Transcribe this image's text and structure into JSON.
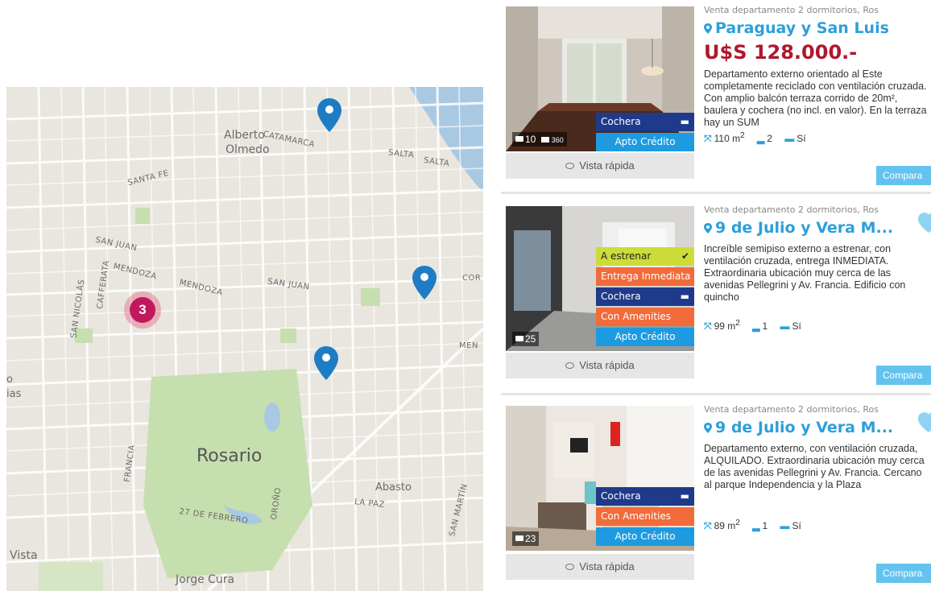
{
  "map": {
    "labels": {
      "alberto": "Alberto",
      "olmedo": "Olmedo",
      "catamarca": "CATAMARCA",
      "salta1": "SALTA",
      "salta2": "SALTA",
      "santafe": "SANTA FE",
      "sanjuan1": "SAN JUAN",
      "mendoza1": "MENDOZA",
      "mendoza2": "MENDOZA",
      "sanjuan2": "SAN JUAN",
      "sannicolas": "SAN NICOLÁS",
      "cafferata": "CAFFERATA",
      "cor": "COR",
      "men": "MEN",
      "rosario": "Rosario",
      "francia": "FRANCIA",
      "orono": "OROÑO",
      "febrero": "27 DE FEBRERO",
      "abasto": "Abasto",
      "lapaz": "LA PAZ",
      "sanmartin": "SAN MARTÍN",
      "vista": "Vista",
      "jorge": "Jorge Cura",
      "edge_o": "o",
      "edge_ias": "ias"
    },
    "cluster_count": "3"
  },
  "colors": {
    "accent_blue": "#2d9fd9",
    "price_red": "#b0172d",
    "pin_blue": "#1e7cc4",
    "cluster": "#c2185b"
  },
  "listings": [
    {
      "subtitle": "Venta departamento 2 dormitorios, Ros",
      "address": "Paraguay y San Luis",
      "price": "U$S 128.000.-",
      "description": "Departamento externo orientado al Este completamente reciclado con ventilación cruzada. Con amplio balcón terraza corrido de 20m², baulera y cochera (no incl. en valor). En la terraza hay un SUM",
      "area": "110 m",
      "area_unit_sup": "2",
      "baths": "2",
      "garage": "Sí",
      "photo_count": "10",
      "photo_extra": "360",
      "badges": [
        {
          "label": "Cochera",
          "icon": "car-icon"
        },
        {
          "label": "Apto Crédito",
          "icon": ""
        }
      ],
      "quick_view": "Vista rápida",
      "compare": "Compara"
    },
    {
      "subtitle": "Venta departamento 2 dormitorios, Ros",
      "address": "9 de Julio y Vera M...",
      "price": "",
      "description": "Increíble semipiso externo a estrenar, con ventilación cruzada, entrega INMEDIATA. Extraordinaria ubicación muy cerca de las avenidas Pellegrini y Av. Francia. Edificio con quincho",
      "area": "99 m",
      "area_unit_sup": "2",
      "baths": "1",
      "garage": "Sí",
      "photo_count": "25",
      "badges": [
        {
          "label": "A estrenar",
          "icon": "check-icon"
        },
        {
          "label": "Entrega Inmediata",
          "icon": ""
        },
        {
          "label": "Cochera",
          "icon": "car-icon"
        },
        {
          "label": "Con Amenities",
          "icon": ""
        },
        {
          "label": "Apto Crédito",
          "icon": ""
        }
      ],
      "quick_view": "Vista rápida",
      "compare": "Compara"
    },
    {
      "subtitle": "Venta departamento 2 dormitorios, Ros",
      "address": "9 de Julio y Vera M...",
      "price": "",
      "description": "Departamento externo, con ventilación cruzada, ALQUILADO. Extraordinaria ubicación muy cerca de las avenidas Pellegrini y Av. Francia. Cercano al parque Independencia y la Plaza",
      "area": "89 m",
      "area_unit_sup": "2",
      "baths": "1",
      "garage": "Sí",
      "photo_count": "23",
      "badges": [
        {
          "label": "Cochera",
          "icon": "car-icon"
        },
        {
          "label": "Con Amenities",
          "icon": ""
        },
        {
          "label": "Apto Crédito",
          "icon": ""
        }
      ],
      "quick_view": "Vista rápida",
      "compare": "Compara"
    }
  ]
}
